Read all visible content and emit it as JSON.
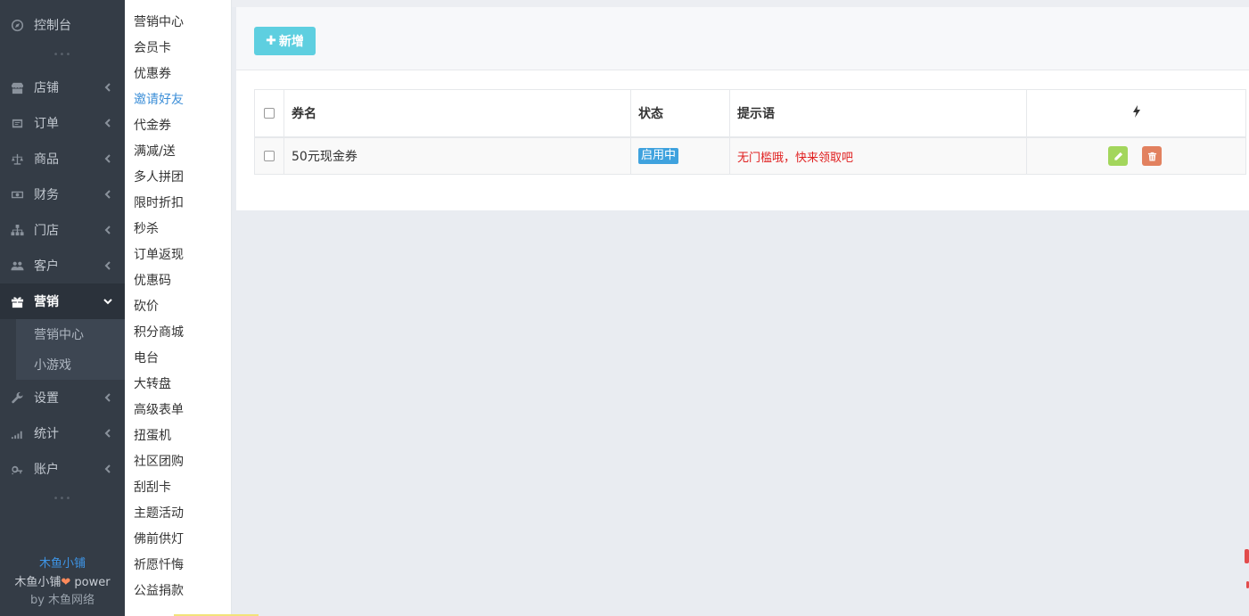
{
  "sidebar": {
    "items": [
      {
        "label": "控制台",
        "icon": "compass-icon",
        "has_arrow": false
      },
      {
        "label": "店铺",
        "icon": "shop-icon",
        "has_arrow": true
      },
      {
        "label": "订单",
        "icon": "order-icon",
        "has_arrow": true
      },
      {
        "label": "商品",
        "icon": "scale-icon",
        "has_arrow": true
      },
      {
        "label": "财务",
        "icon": "money-icon",
        "has_arrow": true
      },
      {
        "label": "门店",
        "icon": "sitemap-icon",
        "has_arrow": true
      },
      {
        "label": "客户",
        "icon": "users-icon",
        "has_arrow": true
      },
      {
        "label": "营销",
        "icon": "gift-icon",
        "has_arrow": true,
        "active": true
      },
      {
        "label": "设置",
        "icon": "wrench-icon",
        "has_arrow": true
      },
      {
        "label": "统计",
        "icon": "signal-icon",
        "has_arrow": true
      },
      {
        "label": "账户",
        "icon": "key-icon",
        "has_arrow": true
      }
    ],
    "sub_items": [
      "营销中心",
      "小游戏"
    ],
    "dots": "•••",
    "footer": {
      "brand": "木鱼小铺",
      "line2_prefix": "木鱼小铺",
      "line2_suffix": " power",
      "line3_prefix": "by ",
      "line3_brand": "木鱼网络"
    }
  },
  "submenu": {
    "items": [
      "营销中心",
      "会员卡",
      "优惠券",
      "邀请好友",
      "代金券",
      "满减/送",
      "多人拼团",
      "限时折扣",
      "秒杀",
      "订单返现",
      "优惠码",
      "砍价",
      "积分商城",
      "电台",
      "大转盘",
      "高级表单",
      "扭蛋机",
      "社区团购",
      "刮刮卡",
      "主题活动",
      "佛前供灯",
      "祈愿忏悔",
      "公益捐款"
    ],
    "selected_index": 3
  },
  "toolbar": {
    "add_label": "新增",
    "add_icon": "plus-icon"
  },
  "table": {
    "headers": {
      "name": "券名",
      "status": "状态",
      "tip": "提示语",
      "action_icon": "bolt-icon"
    },
    "rows": [
      {
        "name": "50元现金券",
        "status": "启用中",
        "tip": "无门槛哦，快来领取吧"
      }
    ]
  },
  "colors": {
    "sidebar_bg": "#343c46",
    "accent_blue": "#3e95e6",
    "add_button": "#5ecfe0",
    "status_badge": "#3fa2de",
    "tip_red": "#e02020",
    "edit_button": "#a3d65c",
    "delete_button": "#e2815f"
  }
}
